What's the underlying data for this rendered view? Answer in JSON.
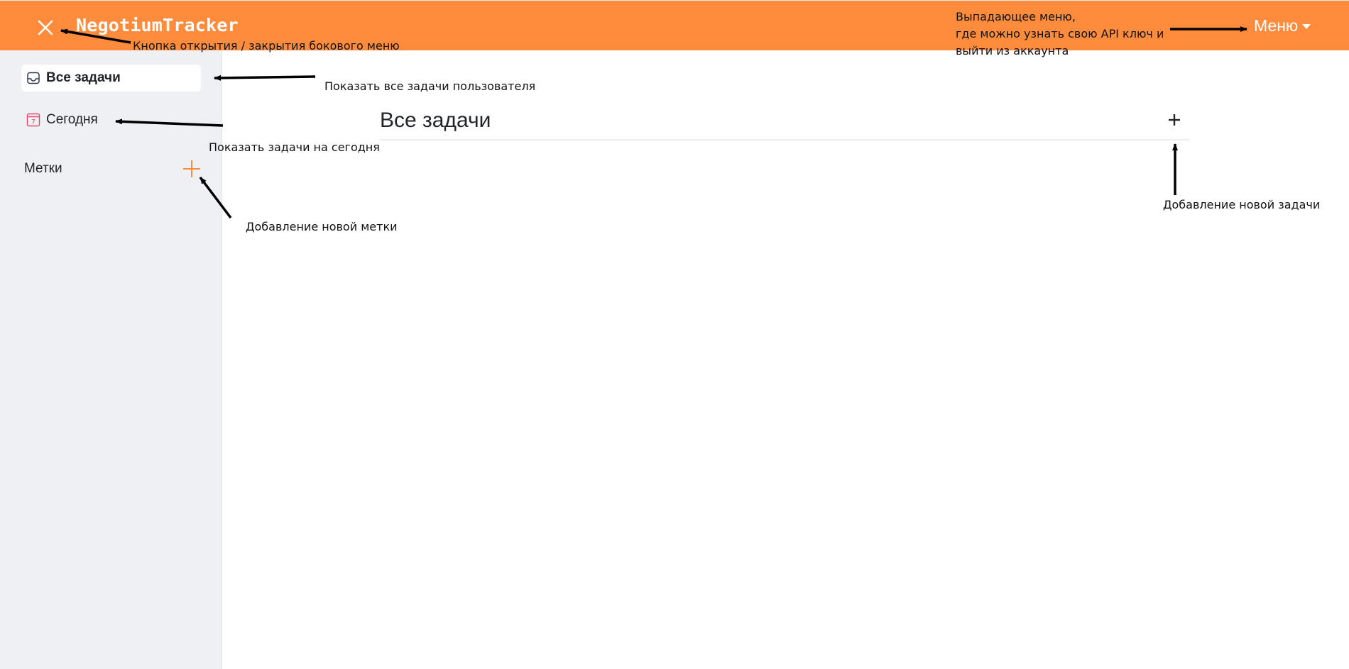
{
  "navbar": {
    "brand": "NegotiumTracker",
    "menu_label": "Меню",
    "background": "#ff8c3c",
    "icons": {
      "toggle": "close-icon",
      "menu_caret": "caret-down-icon"
    }
  },
  "sidebar": {
    "items": [
      {
        "label": "Все задачи",
        "icon": "inbox-icon",
        "active": true
      },
      {
        "label": "Сегодня",
        "icon": "calendar-today-icon",
        "icon_text": "7",
        "active": false
      }
    ],
    "labels_title": "Метки",
    "labels_add_icon": "plus-icon",
    "accent": "#ff8c3c"
  },
  "main": {
    "title": "Все задачи",
    "add_task_icon": "plus-icon"
  },
  "annotations": {
    "toggle": "Кнопка открытия / закрытия бокового меню",
    "menu_line1": "Выпадающее меню,",
    "menu_line2": "где можно узнать свою API ключ и",
    "menu_line3": "выйти из аккаунта",
    "all_tasks": "Показать все задачи пользователя",
    "today": "Показать задачи на сегодня",
    "add_label": "Добавление новой метки",
    "add_task": "Добавление новой задачи"
  }
}
